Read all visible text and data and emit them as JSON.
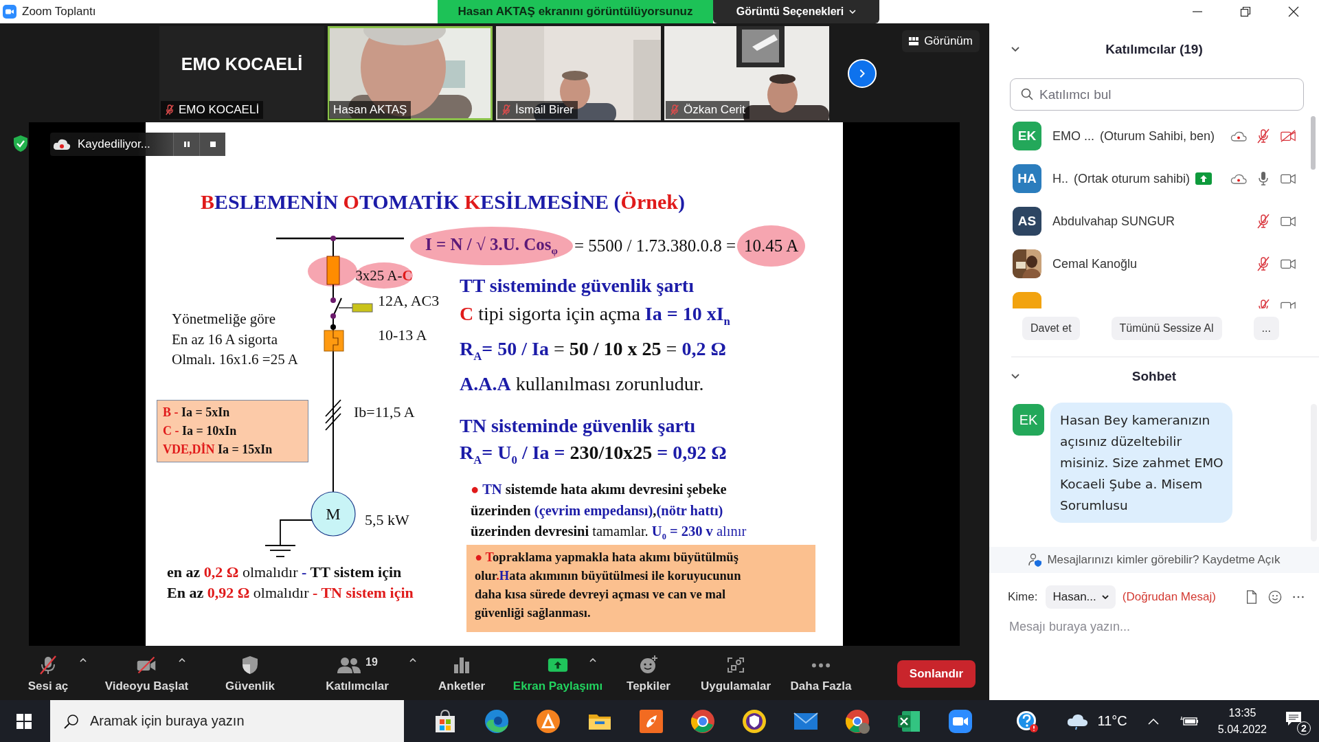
{
  "window": {
    "title": "Zoom Toplantı"
  },
  "share_banner": {
    "text": "Hasan AKTAŞ ekranını görüntülüyorsunuz",
    "options": "Görüntü Seçenekleri"
  },
  "video_tiles": [
    {
      "kind": "name-card",
      "title": "EMO KOCAELİ",
      "label": "EMO KOCAELİ",
      "muted": true,
      "speaking": false
    },
    {
      "kind": "video",
      "label": "Hasan AKTAŞ",
      "muted": false,
      "speaking": true
    },
    {
      "kind": "video",
      "label": "İsmail Birer",
      "muted": true,
      "speaking": false
    },
    {
      "kind": "video",
      "label": "Özkan Cerit",
      "muted": true,
      "speaking": false
    }
  ],
  "view_button": "Görünüm",
  "recording": {
    "text": "Kaydediliyor..."
  },
  "slide": {
    "title": [
      {
        "text": "B",
        "kind": "red"
      },
      {
        "text": "ESLEMENİN ",
        "kind": "blue"
      },
      {
        "text": "O",
        "kind": "red"
      },
      {
        "text": "TOMATİK ",
        "kind": "blue"
      },
      {
        "text": "K",
        "kind": "red"
      },
      {
        "text": "ESİLMESİNE ",
        "kind": "blue"
      },
      {
        "text": "(",
        "kind": "blue"
      },
      {
        "text": "Örnek",
        "kind": "red"
      },
      {
        "text": ")",
        "kind": "blue"
      }
    ],
    "formula": {
      "lhs": "I = N / √ 3.U. Cos$_{φ}$",
      "middle": "= 5500 / 1.73.380.0.8 =",
      "result": "10.45 A"
    },
    "fuse_label": [
      {
        "text": "3x25 A-",
        "kind": "plain"
      },
      {
        "text": "C",
        "kind": "red"
      }
    ],
    "contactor_label": "12A, AC3",
    "relay_label": "10-13 A",
    "load_current": "Ib=11,5 A",
    "motor_label": "M",
    "motor_power": "5,5 kW",
    "regulation_note": [
      "Yönetmeliğe göre",
      "En az 16 A sigorta",
      "Olmalı. 16x1.6 =25 A"
    ],
    "trip_table": [
      [
        {
          "text": "B - ",
          "kind": "red"
        },
        {
          "text": "Ia = 5xIn",
          "kind": "bold"
        }
      ],
      [
        {
          "text": "C - ",
          "kind": "red"
        },
        {
          "text": "Ia = 10xIn",
          "kind": "bold"
        }
      ],
      [
        {
          "text": "VDE,DİN ",
          "kind": "red"
        },
        {
          "text": "Ia = 15xIn",
          "kind": "bold"
        }
      ]
    ],
    "tt_lines": [
      [
        {
          "text": "TT sisteminde güvenlik şartı",
          "kind": "blue"
        }
      ],
      [
        {
          "text": "C",
          "kind": "red"
        },
        {
          "text": " tipi sigorta için açma ",
          "kind": "plain"
        },
        {
          "text": "Ia = 10 xI$_{n}$",
          "kind": "blue"
        }
      ],
      [
        {
          "text": "R$_{A}$= 50 / Ia",
          "kind": "blue"
        },
        {
          "text": " = ",
          "kind": "plain"
        },
        {
          "text": "50 / 10 x 25",
          "kind": "bold"
        },
        {
          "text": " = ",
          "kind": "plain"
        },
        {
          "text": "0,2 Ω",
          "kind": "blue"
        }
      ],
      [
        {
          "text": "A.A.A",
          "kind": "blue"
        },
        {
          "text": " kullanılması zorunludur.",
          "kind": "plain"
        }
      ]
    ],
    "tn_lines": [
      [
        {
          "text": "TN sisteminde güvenlik şartı",
          "kind": "blue"
        }
      ],
      [
        {
          "text": "R$_{A}$= U$_{0}$ / Ia = ",
          "kind": "blue"
        },
        {
          "text": "230/10x25",
          "kind": "bold"
        },
        {
          "text": " = 0,92 Ω",
          "kind": "blue"
        }
      ]
    ],
    "tn_note": [
      [
        {
          "text": "● ",
          "kind": "red"
        },
        {
          "text": "TN",
          "kind": "blue"
        },
        {
          "text": " sistemde hata akımı devresini şebeke",
          "kind": "bold"
        }
      ],
      [
        {
          "text": "üzerinden ",
          "kind": "bold"
        },
        {
          "text": "(çevrim empedansı)",
          "kind": "blue"
        },
        {
          "text": ",",
          "kind": "bold"
        },
        {
          "text": "(nötr hattı)",
          "kind": "blue"
        }
      ],
      [
        {
          "text": "üzerinden devresini",
          "kind": "bold"
        },
        {
          "text": " tamamlar. ",
          "kind": "plain"
        },
        {
          "text": "U$_{0}$ = 230 v",
          "kind": "blue"
        },
        {
          "text": " alınır",
          "kind": "blue-plain"
        }
      ]
    ],
    "earthing_note": [
      [
        {
          "text": "● T",
          "kind": "red"
        },
        {
          "text": "opraklama yapmakla hata akımı büyütülmüş",
          "kind": "bold"
        }
      ],
      [
        {
          "text": "olur",
          "kind": "bold"
        },
        {
          "text": ".",
          "kind": "red"
        },
        {
          "text": "H",
          "kind": "blue"
        },
        {
          "text": "ata akımının büyütülmesi ile koruyucunun",
          "kind": "bold"
        }
      ],
      [
        {
          "text": "daha kısa sürede devreyi açması ve can ve mal",
          "kind": "bold"
        }
      ],
      [
        {
          "text": "güvenliği sağlanması.",
          "kind": "bold"
        }
      ]
    ],
    "minimums": [
      [
        {
          "text": "en az ",
          "kind": "bold"
        },
        {
          "text": "0,2 Ω",
          "kind": "red"
        },
        {
          "text": " olmalıdır ",
          "kind": "plain"
        },
        {
          "text": "- ",
          "kind": "blue"
        },
        {
          "text": "TT sistem için",
          "kind": "bold"
        }
      ],
      [
        {
          "text": "En az ",
          "kind": "bold"
        },
        {
          "text": "0,92 Ω",
          "kind": "red"
        },
        {
          "text": " olmalıdır ",
          "kind": "plain"
        },
        {
          "text": "- TN sistem için",
          "kind": "red"
        }
      ]
    ]
  },
  "toolbar": [
    {
      "kind": "mic",
      "label": "Sesi aç",
      "off": true,
      "active": false,
      "caret": true
    },
    {
      "kind": "video",
      "label": "Videoyu Başlat",
      "off": true,
      "active": false,
      "caret": true
    },
    {
      "kind": "security",
      "label": "Güvenlik",
      "off": false,
      "active": false,
      "caret": false
    },
    {
      "kind": "participants",
      "label": "Katılımcılar",
      "badge": "19",
      "off": false,
      "active": false,
      "caret": true
    },
    {
      "kind": "polls",
      "label": "Anketler",
      "off": false,
      "active": false,
      "caret": false
    },
    {
      "kind": "share",
      "label": "Ekran Paylaşımı",
      "off": false,
      "active": true,
      "caret": true
    },
    {
      "kind": "reactions",
      "label": "Tepkiler",
      "off": false,
      "active": false,
      "caret": false
    },
    {
      "kind": "apps",
      "label": "Uygulamalar",
      "off": false,
      "active": false,
      "caret": false
    },
    {
      "kind": "more",
      "label": "Daha Fazla",
      "off": false,
      "active": false,
      "caret": false
    }
  ],
  "end_button": "Sonlandır",
  "participants_panel": {
    "title": "Katılımcılar (19)",
    "search_placeholder": "Katılımcı bul",
    "participants": [
      {
        "kind": "initials",
        "initials": "EK",
        "color": "#23a85a",
        "name": "EMO ...",
        "role": "(Oturum Sahibi, ben)",
        "sharing": false,
        "recording": true,
        "mic_muted": true,
        "video_off": true
      },
      {
        "kind": "initials",
        "initials": "HA",
        "color": "#2b7dbd",
        "name": "H..",
        "role": "(Ortak oturum sahibi)",
        "sharing": true,
        "recording": true,
        "mic_muted": false,
        "video_off": false
      },
      {
        "kind": "initials",
        "initials": "AS",
        "color": "#2d4562",
        "name": "Abdulvahap SUNGUR",
        "sharing": false,
        "recording": false,
        "mic_muted": true,
        "video_off": false
      },
      {
        "name": "Cemal Kanoğlu",
        "sharing": false,
        "recording": false,
        "mic_muted": true,
        "video_off": false
      },
      {
        "kind": "partial",
        "color": "#f2a30f",
        "sharing": false,
        "recording": false,
        "mic_muted": true,
        "video_off": false
      }
    ],
    "buttons": [
      "Davet et",
      "Tümünü Sessize Al",
      "..."
    ]
  },
  "chat": {
    "title": "Sohbet",
    "messages": [
      {
        "initials": "EK",
        "color": "#23a85a",
        "text": "Hasan Bey kameranızın açısınız düzeltebilir misiniz. Size zahmet EMO Kocaeli Şube a. Misem Sorumlusu"
      }
    ],
    "privacy_note": "Mesajlarınızı kimler görebilir? Kaydetme Açık",
    "to_label": "Kime:",
    "recipient": "Hasan...",
    "direct": "(Doğrudan Mesaj)",
    "placeholder": "Mesajı buraya yazın..."
  },
  "taskbar": {
    "search_placeholder": "Aramak için buraya yazın",
    "temperature": "11°C",
    "time": "13:35",
    "date": "5.04.2022",
    "notification_count": "2"
  }
}
